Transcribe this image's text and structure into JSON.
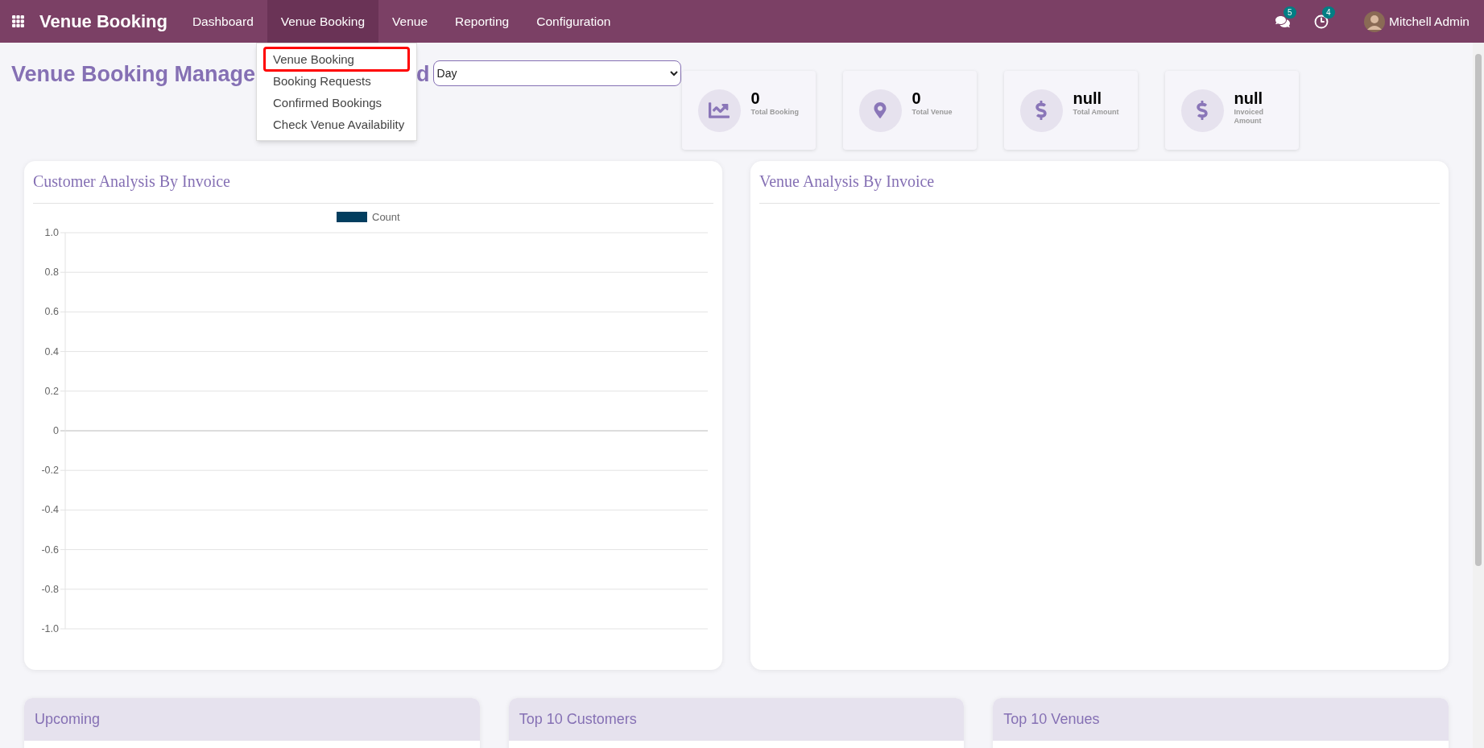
{
  "navbar": {
    "app_name": "Venue Booking",
    "menu": [
      {
        "label": "Dashboard",
        "selected": false
      },
      {
        "label": "Venue Booking",
        "selected": true
      },
      {
        "label": "Venue",
        "selected": false
      },
      {
        "label": "Reporting",
        "selected": false
      },
      {
        "label": "Configuration",
        "selected": false
      }
    ],
    "chat_count": "5",
    "activity_count": "4",
    "user": "Mitchell Admin"
  },
  "dropdown": [
    {
      "label": "Venue Booking",
      "highlighted": true
    },
    {
      "label": "Booking Requests",
      "highlighted": false
    },
    {
      "label": "Confirmed Bookings",
      "highlighted": false
    },
    {
      "label": "Check Venue Availability",
      "highlighted": false
    }
  ],
  "title_parts": [
    "Venue Booking Manage",
    "d"
  ],
  "period_select": {
    "value": "Day"
  },
  "kpis": [
    {
      "kind": "chart",
      "value": "0",
      "label": "Total Booking"
    },
    {
      "kind": "pin",
      "value": "0",
      "label": "Total Venue"
    },
    {
      "kind": "dollar",
      "value": "null",
      "label": "Total Amount"
    },
    {
      "kind": "dollar",
      "value": "null",
      "label": "Invoiced Amount"
    }
  ],
  "charts": [
    {
      "title": "Customer Analysis By Invoice",
      "chart_data": {
        "type": "bar",
        "grid": true,
        "series": [
          {
            "name": "Count",
            "color": "#023e5f"
          }
        ],
        "ylim": [
          -1,
          1
        ],
        "yticks": [
          {
            "value": 1,
            "label": "1.0"
          },
          {
            "value": 0.8,
            "label": "0.8"
          },
          {
            "value": 0.6,
            "label": "0.6"
          },
          {
            "value": 0.4,
            "label": "0.4"
          },
          {
            "value": 0.2,
            "label": "0.2"
          },
          {
            "value": 0,
            "label": "0"
          },
          {
            "value": -0.2,
            "label": "-0.2"
          },
          {
            "value": -0.4,
            "label": "-0.4"
          },
          {
            "value": -0.6,
            "label": "-0.6"
          },
          {
            "value": -0.8,
            "label": "-0.8"
          },
          {
            "value": -1,
            "label": "-1.0"
          }
        ]
      }
    },
    {
      "title": "Venue Analysis By Invoice"
    }
  ],
  "lists": [
    {
      "title": "Upcoming"
    },
    {
      "title": "Top 10 Customers"
    },
    {
      "title": "Top 10 Venues"
    }
  ]
}
